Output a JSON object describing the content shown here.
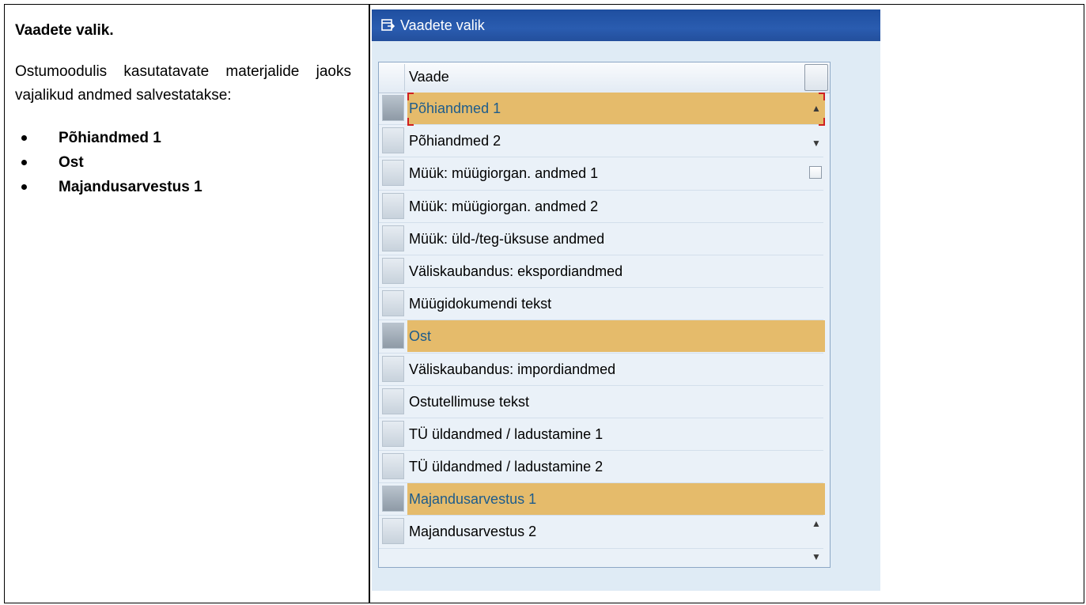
{
  "doc": {
    "heading": "Vaadete valik.",
    "paragraph": "Ostumoodulis kasutatavate materjalide jaoks vajalikud andmed salvestatakse:",
    "bullets": [
      "Põhiandmed 1",
      "Ost",
      "Majandusarvestus 1"
    ]
  },
  "dialog": {
    "title": "Vaadete valik",
    "title_icon": "view-selection-icon",
    "column_header": "Vaade",
    "rows": [
      {
        "label": "Põhiandmed 1",
        "selected": true
      },
      {
        "label": "Põhiandmed 2",
        "selected": false
      },
      {
        "label": "Müük: müügiorgan. andmed 1",
        "selected": false
      },
      {
        "label": "Müük: müügiorgan. andmed 2",
        "selected": false
      },
      {
        "label": "Müük: üld-/teg-üksuse andmed",
        "selected": false
      },
      {
        "label": "Väliskaubandus: ekspordiandmed",
        "selected": false
      },
      {
        "label": "Müügidokumendi tekst",
        "selected": false
      },
      {
        "label": "Ost",
        "selected": true
      },
      {
        "label": "Väliskaubandus: impordiandmed",
        "selected": false
      },
      {
        "label": "Ostutellimuse tekst",
        "selected": false
      },
      {
        "label": "TÜ üldandmed / ladustamine 1",
        "selected": false
      },
      {
        "label": "TÜ üldandmed / ladustamine 2",
        "selected": false
      },
      {
        "label": "Majandusarvestus 1",
        "selected": true
      },
      {
        "label": "Majandusarvestus 2",
        "selected": false
      }
    ],
    "colors": {
      "titlebar": "#2a5cb0",
      "selected_row": "#e5bb6b",
      "selected_text": "#1d5c8c",
      "focus_marker": "#d02020"
    }
  }
}
